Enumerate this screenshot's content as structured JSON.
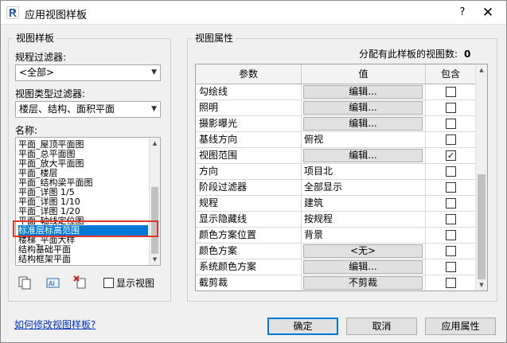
{
  "window": {
    "title": "应用视图样板",
    "help_icon": "?",
    "close_icon": "✕"
  },
  "left_group": {
    "title": "视图样板",
    "discipline_filter_label": "规程过滤器:",
    "discipline_filter_value": "<全部>",
    "view_type_filter_label": "视图类型过滤器:",
    "view_type_filter_value": "楼层、结构、面积平面",
    "names_label": "名称:",
    "names": [
      "平面_屋顶平面图",
      "平面_总平面图",
      "平面_放大平面图",
      "平面_楼层",
      "平面_结构梁平面图",
      "平面_详图 1/5",
      "平面_详图 1/10",
      "平面_详图 1/20",
      "平面_轴线定位图",
      "标准层标高范围",
      "楼梯_平面大样",
      "结构基础平面",
      "结构框架平面"
    ],
    "selected_name": "标准层标高范围",
    "show_views_label": "显示视图"
  },
  "right_group": {
    "title": "视图属性",
    "assigned_count_label": "分配有此样板的视图数:",
    "assigned_count": "0",
    "columns": [
      "参数",
      "值",
      "包含"
    ],
    "rows": [
      {
        "param": "勾绘线",
        "value": "编辑...",
        "value_is_button": true,
        "include": false
      },
      {
        "param": "照明",
        "value": "编辑...",
        "value_is_button": true,
        "include": false
      },
      {
        "param": "摄影曝光",
        "value": "编辑...",
        "value_is_button": true,
        "include": false
      },
      {
        "param": "基线方向",
        "value": "俯视",
        "value_is_button": false,
        "include": false
      },
      {
        "param": "视图范围",
        "value": "编辑...",
        "value_is_button": true,
        "include": true
      },
      {
        "param": "方向",
        "value": "项目北",
        "value_is_button": false,
        "include": false
      },
      {
        "param": "阶段过滤器",
        "value": "全部显示",
        "value_is_button": false,
        "include": false
      },
      {
        "param": "规程",
        "value": "建筑",
        "value_is_button": false,
        "include": false
      },
      {
        "param": "显示隐藏线",
        "value": "按规程",
        "value_is_button": false,
        "include": false
      },
      {
        "param": "颜色方案位置",
        "value": "背景",
        "value_is_button": false,
        "include": false
      },
      {
        "param": "颜色方案",
        "value": "<无>",
        "value_is_button": true,
        "include": false
      },
      {
        "param": "系统颜色方案",
        "value": "编辑...",
        "value_is_button": true,
        "include": false
      },
      {
        "param": "截剪裁",
        "value": "不剪裁",
        "value_is_button": true,
        "include": false
      }
    ]
  },
  "footer": {
    "help_link": "如何修改视图样板?",
    "ok_label": "确定",
    "cancel_label": "取消",
    "apply_label": "应用属性"
  },
  "colors": {
    "selection": "#0078d7",
    "highlight_box": "#e0352b",
    "link": "#0033cc"
  }
}
